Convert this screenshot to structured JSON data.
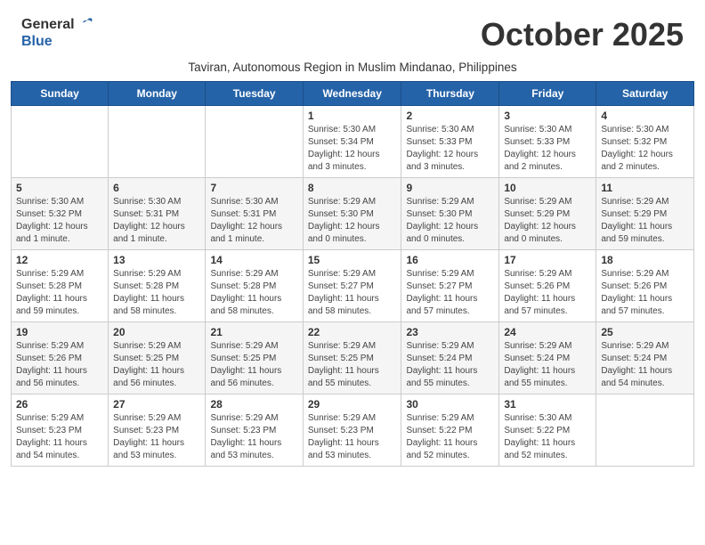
{
  "header": {
    "logo_general": "General",
    "logo_blue": "Blue",
    "month_title": "October 2025",
    "subtitle": "Taviran, Autonomous Region in Muslim Mindanao, Philippines"
  },
  "days_of_week": [
    "Sunday",
    "Monday",
    "Tuesday",
    "Wednesday",
    "Thursday",
    "Friday",
    "Saturday"
  ],
  "weeks": [
    [
      {
        "day": "",
        "info": ""
      },
      {
        "day": "",
        "info": ""
      },
      {
        "day": "",
        "info": ""
      },
      {
        "day": "1",
        "info": "Sunrise: 5:30 AM\nSunset: 5:34 PM\nDaylight: 12 hours\nand 3 minutes."
      },
      {
        "day": "2",
        "info": "Sunrise: 5:30 AM\nSunset: 5:33 PM\nDaylight: 12 hours\nand 3 minutes."
      },
      {
        "day": "3",
        "info": "Sunrise: 5:30 AM\nSunset: 5:33 PM\nDaylight: 12 hours\nand 2 minutes."
      },
      {
        "day": "4",
        "info": "Sunrise: 5:30 AM\nSunset: 5:32 PM\nDaylight: 12 hours\nand 2 minutes."
      }
    ],
    [
      {
        "day": "5",
        "info": "Sunrise: 5:30 AM\nSunset: 5:32 PM\nDaylight: 12 hours\nand 1 minute."
      },
      {
        "day": "6",
        "info": "Sunrise: 5:30 AM\nSunset: 5:31 PM\nDaylight: 12 hours\nand 1 minute."
      },
      {
        "day": "7",
        "info": "Sunrise: 5:30 AM\nSunset: 5:31 PM\nDaylight: 12 hours\nand 1 minute."
      },
      {
        "day": "8",
        "info": "Sunrise: 5:29 AM\nSunset: 5:30 PM\nDaylight: 12 hours\nand 0 minutes."
      },
      {
        "day": "9",
        "info": "Sunrise: 5:29 AM\nSunset: 5:30 PM\nDaylight: 12 hours\nand 0 minutes."
      },
      {
        "day": "10",
        "info": "Sunrise: 5:29 AM\nSunset: 5:29 PM\nDaylight: 12 hours\nand 0 minutes."
      },
      {
        "day": "11",
        "info": "Sunrise: 5:29 AM\nSunset: 5:29 PM\nDaylight: 11 hours\nand 59 minutes."
      }
    ],
    [
      {
        "day": "12",
        "info": "Sunrise: 5:29 AM\nSunset: 5:28 PM\nDaylight: 11 hours\nand 59 minutes."
      },
      {
        "day": "13",
        "info": "Sunrise: 5:29 AM\nSunset: 5:28 PM\nDaylight: 11 hours\nand 58 minutes."
      },
      {
        "day": "14",
        "info": "Sunrise: 5:29 AM\nSunset: 5:28 PM\nDaylight: 11 hours\nand 58 minutes."
      },
      {
        "day": "15",
        "info": "Sunrise: 5:29 AM\nSunset: 5:27 PM\nDaylight: 11 hours\nand 58 minutes."
      },
      {
        "day": "16",
        "info": "Sunrise: 5:29 AM\nSunset: 5:27 PM\nDaylight: 11 hours\nand 57 minutes."
      },
      {
        "day": "17",
        "info": "Sunrise: 5:29 AM\nSunset: 5:26 PM\nDaylight: 11 hours\nand 57 minutes."
      },
      {
        "day": "18",
        "info": "Sunrise: 5:29 AM\nSunset: 5:26 PM\nDaylight: 11 hours\nand 57 minutes."
      }
    ],
    [
      {
        "day": "19",
        "info": "Sunrise: 5:29 AM\nSunset: 5:26 PM\nDaylight: 11 hours\nand 56 minutes."
      },
      {
        "day": "20",
        "info": "Sunrise: 5:29 AM\nSunset: 5:25 PM\nDaylight: 11 hours\nand 56 minutes."
      },
      {
        "day": "21",
        "info": "Sunrise: 5:29 AM\nSunset: 5:25 PM\nDaylight: 11 hours\nand 56 minutes."
      },
      {
        "day": "22",
        "info": "Sunrise: 5:29 AM\nSunset: 5:25 PM\nDaylight: 11 hours\nand 55 minutes."
      },
      {
        "day": "23",
        "info": "Sunrise: 5:29 AM\nSunset: 5:24 PM\nDaylight: 11 hours\nand 55 minutes."
      },
      {
        "day": "24",
        "info": "Sunrise: 5:29 AM\nSunset: 5:24 PM\nDaylight: 11 hours\nand 55 minutes."
      },
      {
        "day": "25",
        "info": "Sunrise: 5:29 AM\nSunset: 5:24 PM\nDaylight: 11 hours\nand 54 minutes."
      }
    ],
    [
      {
        "day": "26",
        "info": "Sunrise: 5:29 AM\nSunset: 5:23 PM\nDaylight: 11 hours\nand 54 minutes."
      },
      {
        "day": "27",
        "info": "Sunrise: 5:29 AM\nSunset: 5:23 PM\nDaylight: 11 hours\nand 53 minutes."
      },
      {
        "day": "28",
        "info": "Sunrise: 5:29 AM\nSunset: 5:23 PM\nDaylight: 11 hours\nand 53 minutes."
      },
      {
        "day": "29",
        "info": "Sunrise: 5:29 AM\nSunset: 5:23 PM\nDaylight: 11 hours\nand 53 minutes."
      },
      {
        "day": "30",
        "info": "Sunrise: 5:29 AM\nSunset: 5:22 PM\nDaylight: 11 hours\nand 52 minutes."
      },
      {
        "day": "31",
        "info": "Sunrise: 5:30 AM\nSunset: 5:22 PM\nDaylight: 11 hours\nand 52 minutes."
      },
      {
        "day": "",
        "info": ""
      }
    ]
  ]
}
